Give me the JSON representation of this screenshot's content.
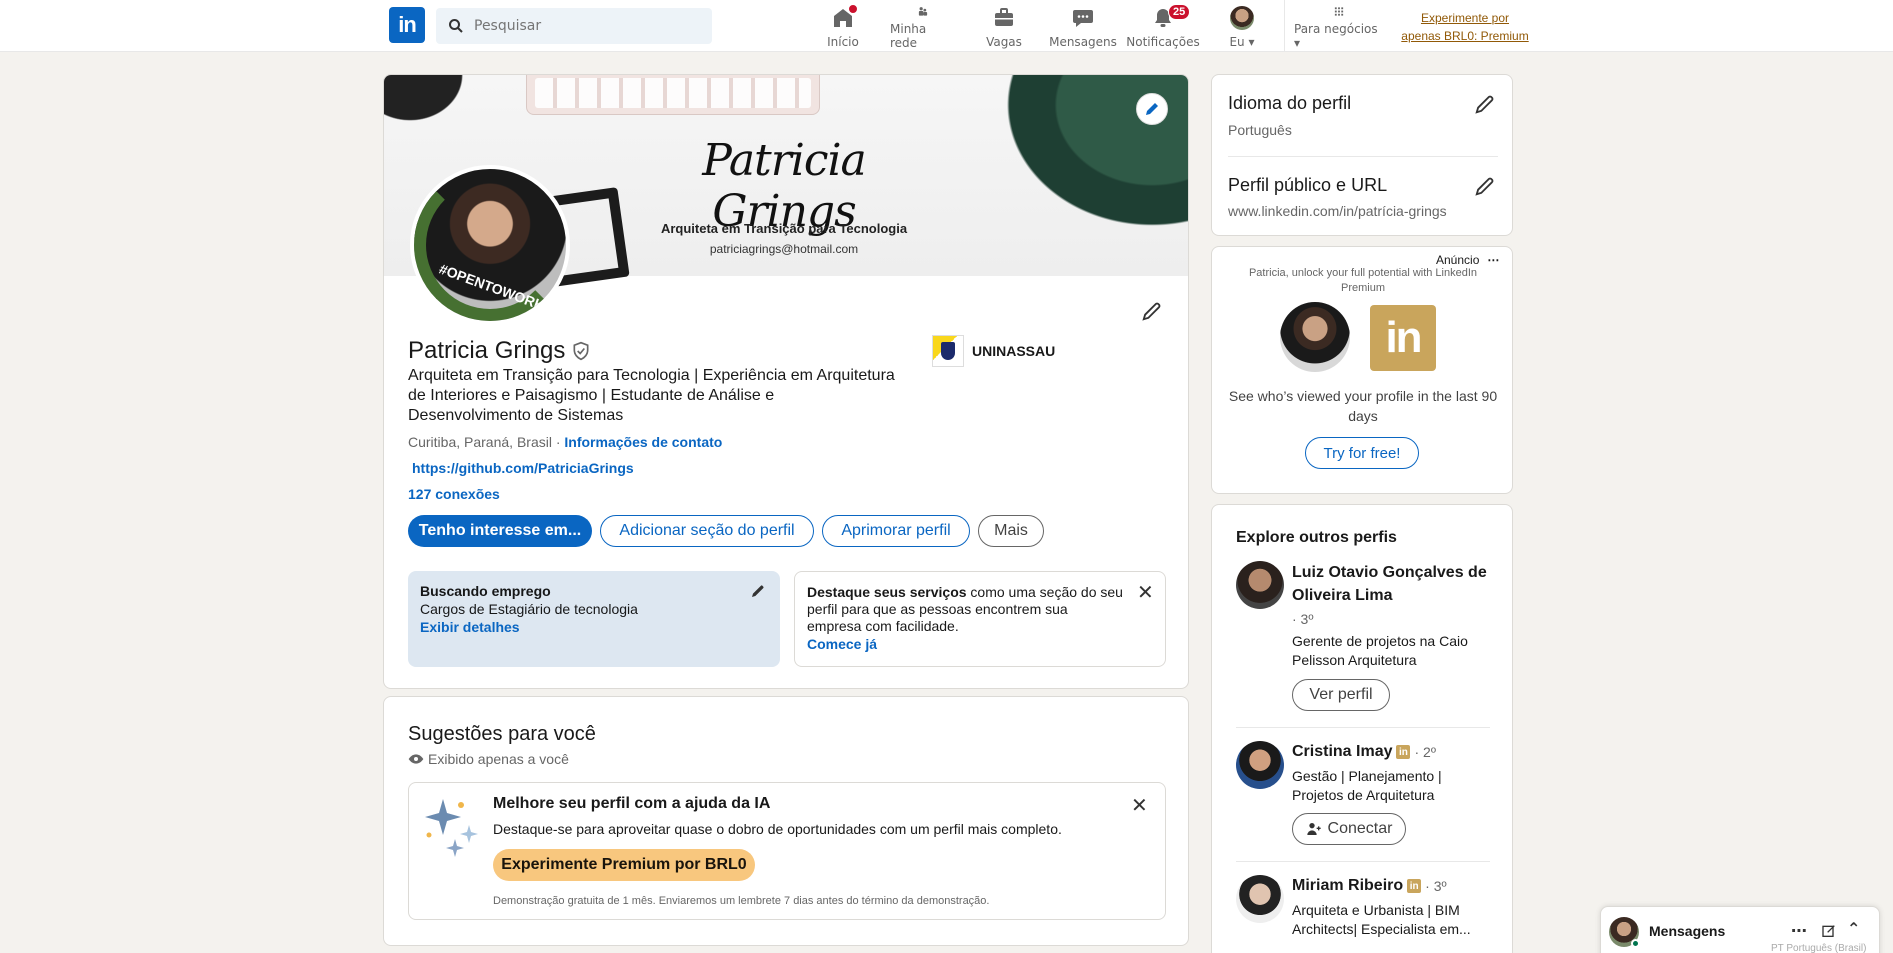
{
  "header": {
    "search_placeholder": "Pesquisar",
    "nav": [
      {
        "label": "Início",
        "badge": ""
      },
      {
        "label": "Minha rede",
        "badge": ""
      },
      {
        "label": "Vagas",
        "badge": ""
      },
      {
        "label": "Mensagens",
        "badge": ""
      },
      {
        "label": "Notificações",
        "badge": "25"
      },
      {
        "label": "Eu",
        "badge": ""
      },
      {
        "label": "Para negócios",
        "badge": ""
      }
    ],
    "premium_line1": "Experimente por",
    "premium_line2": "apenas BRL0: Premium"
  },
  "cover": {
    "signature": "Patricia Grings",
    "subtitle": "Arquiteta em Transição para Tecnologia",
    "email": "patriciagrings@hotmail.com",
    "frame_text": "#OPENTOWORK"
  },
  "profile": {
    "name": "Patricia Grings",
    "headline": "Arquiteta em Transição para Tecnologia | Experiência em Arquitetura de Interiores e Paisagismo | Estudante de Análise e Desenvolvimento de Sistemas",
    "location": "Curitiba, Paraná, Brasil ·",
    "contact_link": "Informações de contato",
    "website": "https://github.com/PatriciaGrings",
    "connections": "127 conexões",
    "school": "UNINASSAU",
    "buttons": {
      "interest": "Tenho interesse em...",
      "add_section": "Adicionar seção do perfil",
      "improve": "Aprimorar perfil",
      "more": "Mais"
    },
    "otw": {
      "title": "Buscando emprego",
      "roles": "Cargos de Estagiário de tecnologia",
      "details": "Exibir detalhes"
    },
    "services": {
      "bold": "Destaque seus serviços",
      "text": " como uma seção do seu perfil para que as pessoas encontrem sua empresa com facilidade.",
      "link": "Comece já"
    }
  },
  "suggestions": {
    "title": "Sugestões para você",
    "private": "Exibido apenas a você",
    "ai_title": "Melhore seu perfil com a ajuda da IA",
    "ai_text": "Destaque-se para aproveitar quase o dobro de oportunidades com um perfil mais completo.",
    "ai_button": "Experimente Premium por BRL0",
    "ai_note": "Demonstração gratuita de 1 mês. Enviaremos um lembrete 7 dias antes do término da demonstração."
  },
  "sidebar": {
    "lang_title": "Idioma do perfil",
    "lang_value": "Português",
    "url_title": "Perfil público e URL",
    "url_value": "www.linkedin.com/in/patrícia-grings",
    "ad_label": "Anúncio",
    "ad_line": "Patricia, unlock your full potential with LinkedIn Premium",
    "ad_text": "See who’s viewed your profile in the last 90 days",
    "ad_button": "Try for free!",
    "explore_title": "Explore outros perfis",
    "people": [
      {
        "name": "Luiz Otavio Gonçalves de Oliveira Lima",
        "degree": "· 3º",
        "title": "Gerente de projetos na Caio Pelisson Arquitetura",
        "button": "Ver perfil"
      },
      {
        "name": "Cristina Imay",
        "degree": "· 2º",
        "title": "Gestão | Planejamento | Projetos de Arquitetura",
        "button": "Conectar"
      },
      {
        "name": "Miriam Ribeiro",
        "degree": "· 3º",
        "title": "Arquiteta e Urbanista | BIM Architects| Especialista em..."
      }
    ]
  },
  "messaging": {
    "label": "Mensagens",
    "footer": "PT Português (Brasil)"
  },
  "colors": {
    "brand": "#0a66c2",
    "premium": "#f8c77e",
    "badge": "#cb112d"
  }
}
